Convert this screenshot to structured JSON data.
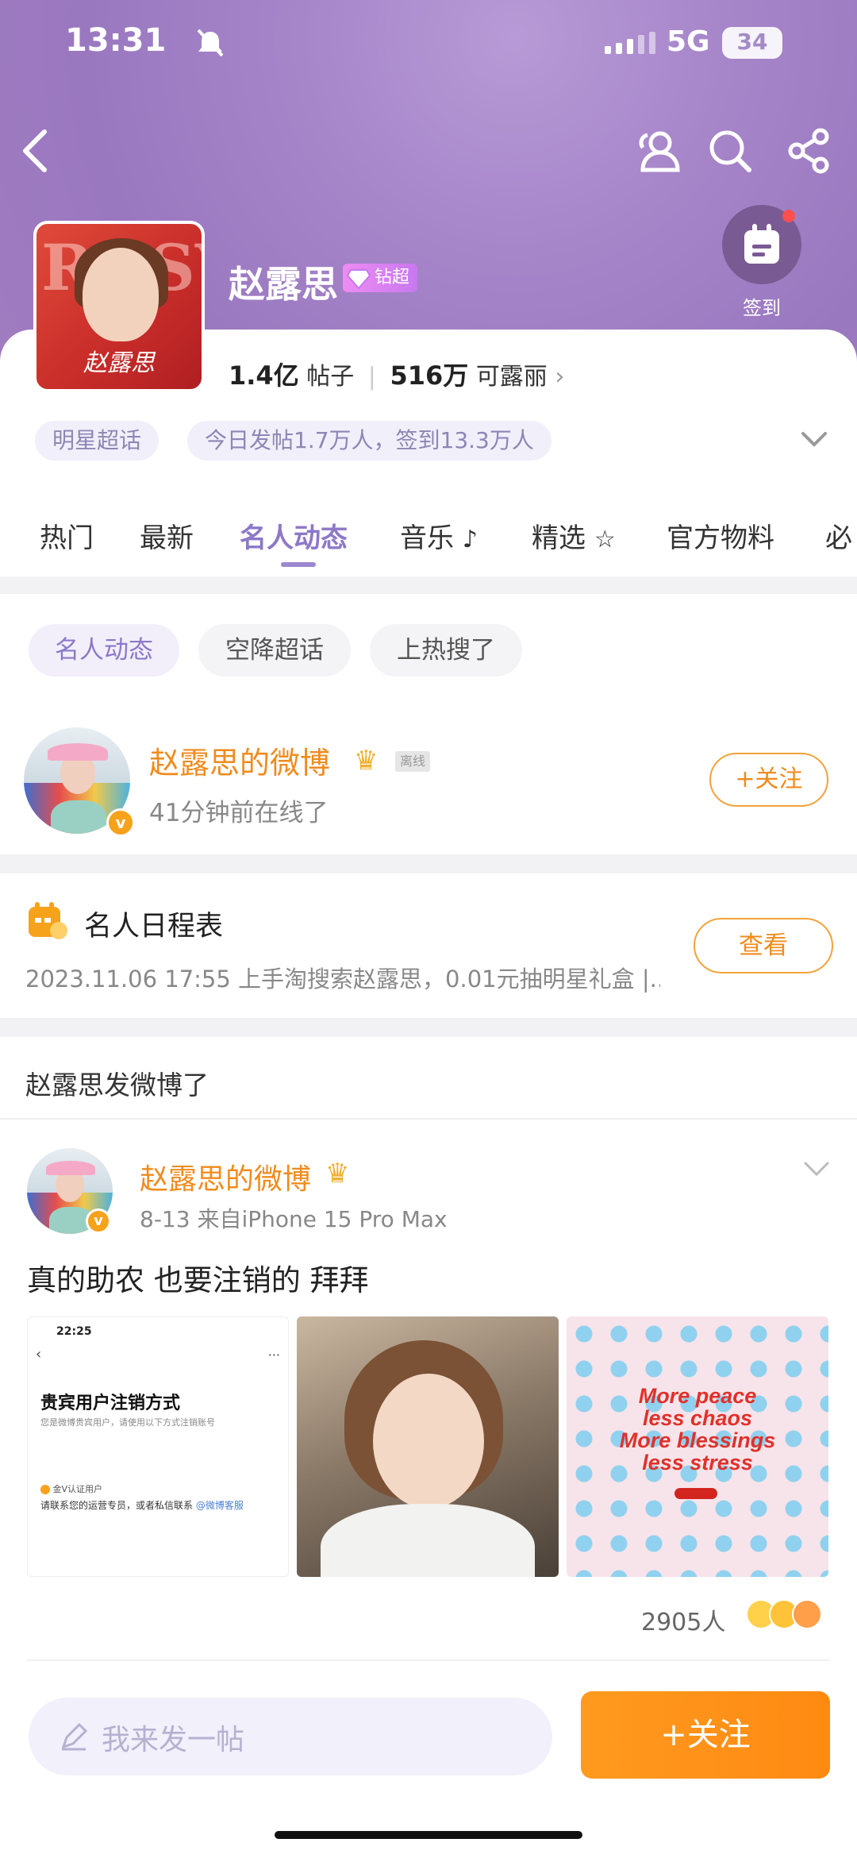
{
  "status_bar": {
    "time": "13:31",
    "network": "5G",
    "battery": "34"
  },
  "header": {
    "title": "赵露思",
    "badge_label": "钻超",
    "cover_text": "赵露思",
    "cover_big": "ROSY",
    "signin_label": "签到",
    "posts_count": "1.4亿",
    "posts_label": "帖子",
    "fans_count": "516万",
    "fans_label": "可露丽",
    "pills": [
      "明星超话",
      "今日发帖1.7万人，签到13.3万人"
    ]
  },
  "tabs": [
    "热门",
    "最新",
    "名人动态",
    "音乐",
    "精选",
    "官方物料",
    "必"
  ],
  "filters": [
    "名人动态",
    "空降超话",
    "上热搜了"
  ],
  "celebrity": {
    "name": "赵露思的微博",
    "offline_tag": "离线",
    "online_text": "41分钟前在线了",
    "follow_label": "+关注"
  },
  "schedule": {
    "title": "名人日程表",
    "desc": "2023.11.06 17:55 上手淘搜索赵露思，0.01元抽明星礼盒 |...",
    "view_label": "查看"
  },
  "section_title": "赵露思发微博了",
  "post": {
    "author": "赵露思的微博",
    "meta": "8-13  来自iPhone 15 Pro Max",
    "text": "真的助农 也要注销的 拜拜",
    "image1": {
      "time": "22:25",
      "heading": "贵宾用户注销方式",
      "sub": "您是微博贵宾用户，请使用以下方式注销账号",
      "tag": "金V认证用户",
      "contact": "请联系您的运营专员，或者私信联系",
      "link": "@微博客服"
    },
    "image3_lines": [
      "More peace",
      "less chaos",
      "More blessings",
      "less stress"
    ],
    "reactions": "2905人"
  },
  "bottom": {
    "compose_placeholder": "我来发一帖",
    "follow_label": "+关注"
  },
  "colors": {
    "accent_purple": "#8d78c8",
    "accent_orange": "#f08b1d",
    "follow_orange": "#ff8a12"
  }
}
